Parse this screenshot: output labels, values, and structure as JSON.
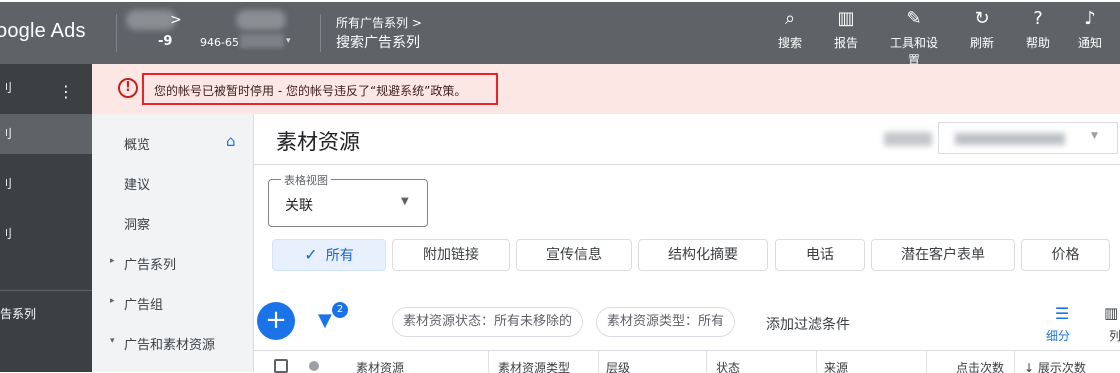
{
  "topbar": {
    "logo": "oogle Ads",
    "account_chevron": ">",
    "account_id_prefix": "-9",
    "account_id_partial": "946-65",
    "account_dropdown": "▾",
    "breadcrumb_parent": "所有广告系列 >",
    "breadcrumb_current": "搜索广告系列",
    "actions": [
      {
        "icon": "search-icon",
        "glyph": "⌕",
        "label": "搜索"
      },
      {
        "icon": "reports-icon",
        "glyph": "▥",
        "label": "报告"
      },
      {
        "icon": "tools-icon",
        "glyph": "✎",
        "label": "工具和设置"
      },
      {
        "icon": "refresh-icon",
        "glyph": "↻",
        "label": "刷新"
      },
      {
        "icon": "help-icon",
        "glyph": "?",
        "label": "帮助"
      },
      {
        "icon": "bell-icon",
        "glyph": "♪",
        "label": "通知"
      }
    ]
  },
  "leftnav": {
    "items": [
      "刂",
      "刂",
      "刂",
      "刂",
      "告系列"
    ],
    "more_glyph": "⋮"
  },
  "alert": {
    "icon_glyph": "!",
    "message": "您的帐号已被暂时停用 - 您的帐号违反了“规避系统”政策。"
  },
  "subnav": {
    "items": [
      "概览",
      "建议",
      "洞察",
      "广告系列",
      "广告组",
      "广告和素材资源"
    ],
    "expand_glyph": "▸",
    "collapse_glyph": "▾",
    "home_glyph": "⌂"
  },
  "main": {
    "title": "素材资源",
    "view": {
      "label": "表格视图",
      "value": "关联",
      "arrow": "▼"
    },
    "chips": [
      {
        "label": "所有",
        "selected": true
      },
      {
        "label": "附加链接",
        "selected": false
      },
      {
        "label": "宣传信息",
        "selected": false
      },
      {
        "label": "结构化摘要",
        "selected": false
      },
      {
        "label": "电话",
        "selected": false
      },
      {
        "label": "潜在客户表单",
        "selected": false
      },
      {
        "label": "价格",
        "selected": false
      }
    ],
    "check_glyph": "✓",
    "toolbar": {
      "add_glyph": "+",
      "filter_glyph": "▼",
      "filter_count": "2",
      "filter_status": "素材资源状态：所有未移除的",
      "filter_type": "素材资源类型：所有",
      "add_filter": "添加过滤条件",
      "segment_glyph": "☰",
      "segment_label": "细分",
      "columns_glyph": "▥",
      "columns_label": "列"
    },
    "table_headers": [
      "素材资源",
      "素材资源类型",
      "层级",
      "状态",
      "来源",
      "点击次数",
      "↓ 展示次数"
    ]
  },
  "colors": {
    "topbar": "#5f6368",
    "leftnav": "#3c4043",
    "alert_bg": "#fde7e5",
    "alert_border": "#e8232a",
    "accent": "#1a73e8"
  }
}
